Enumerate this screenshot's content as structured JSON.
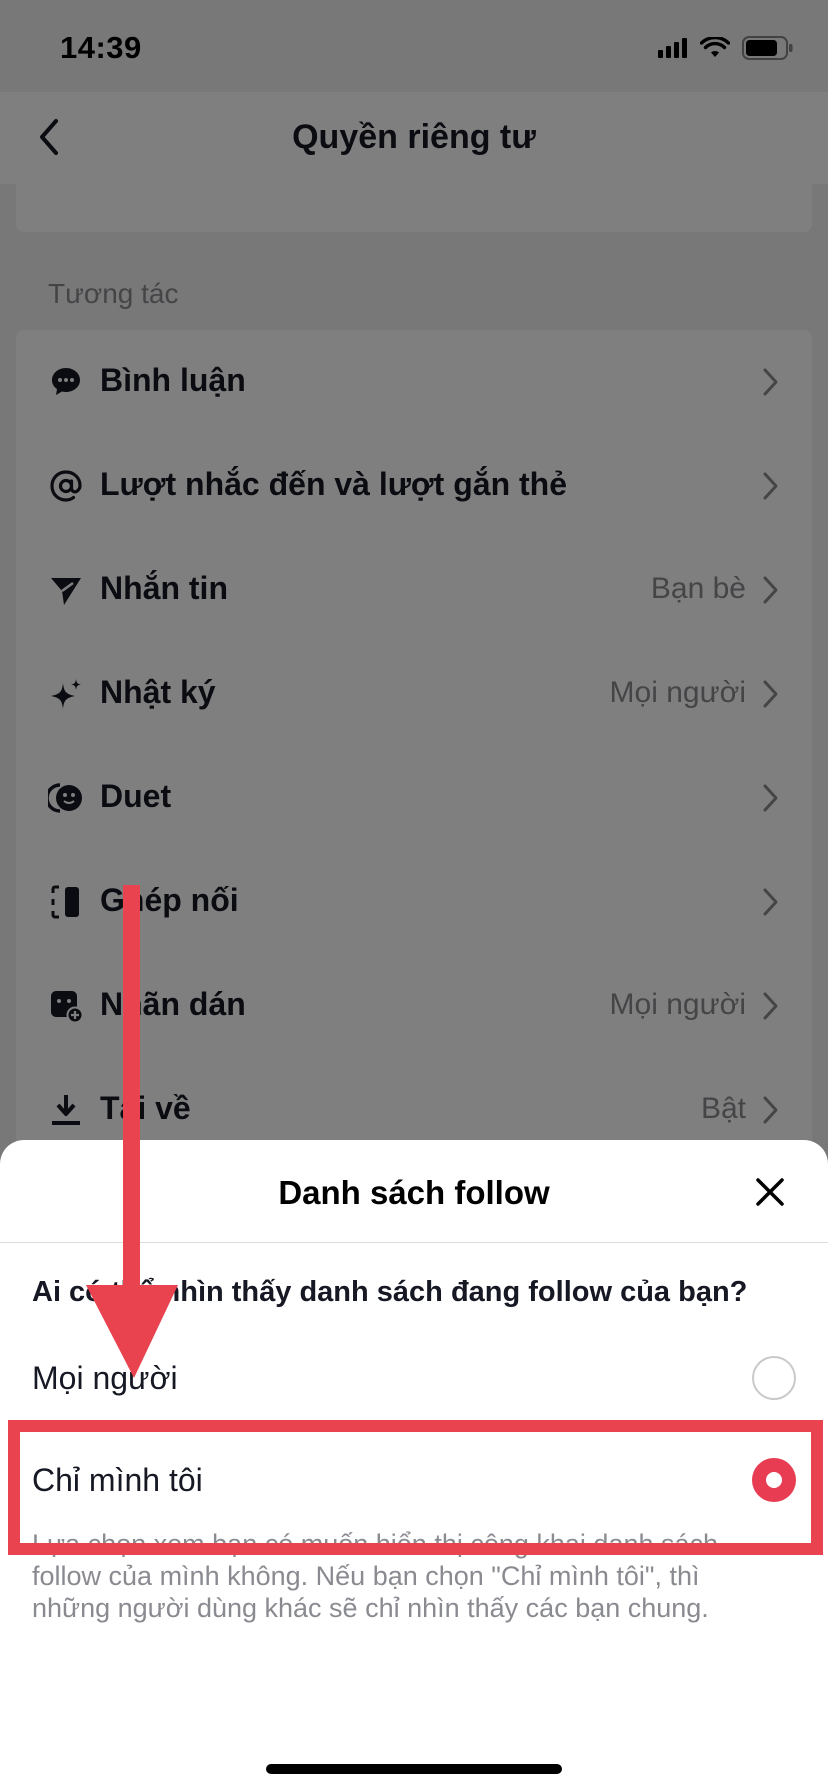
{
  "status_bar": {
    "time": "14:39",
    "icons": [
      "signal-icon",
      "wifi-icon",
      "battery-icon"
    ]
  },
  "nav": {
    "title": "Quyền riêng tư",
    "back_icon": "chevron-left-icon"
  },
  "section": {
    "title": "Tương tác",
    "items": [
      {
        "label": "Bình luận",
        "value": "",
        "icon": "comment-icon"
      },
      {
        "label": "Lượt nhắc đến và lượt gắn thẻ",
        "value": "",
        "icon": "at-icon"
      },
      {
        "label": "Nhắn tin",
        "value": "Bạn bè",
        "icon": "send-icon"
      },
      {
        "label": "Nhật ký",
        "value": "Mọi người",
        "icon": "sparkle-icon"
      },
      {
        "label": "Duet",
        "value": "",
        "icon": "duet-icon"
      },
      {
        "label": "Ghép nối",
        "value": "",
        "icon": "stitch-icon"
      },
      {
        "label": "Nhãn dán",
        "value": "Mọi người",
        "icon": "sticker-icon"
      },
      {
        "label": "Tải về",
        "value": "Bật",
        "icon": "download-icon"
      }
    ]
  },
  "sheet": {
    "title": "Danh sách follow",
    "close_icon": "close-icon",
    "question": "Ai có thể nhìn thấy danh sách đang follow của bạn?",
    "options": [
      {
        "label": "Mọi người",
        "selected": false
      },
      {
        "label": "Chỉ mình tôi",
        "selected": true
      }
    ],
    "description": "Lựa chọn xem bạn có muốn hiển thị công khai danh sách follow của mình không. Nếu bạn chọn \"Chỉ mình tôi\", thì những người dùng khác sẽ chỉ nhìn thấy các bạn chung."
  },
  "colors": {
    "accent": "#e83c52",
    "annotation": "#e8434f",
    "overlay": "rgba(0,0,0,0.5)"
  }
}
